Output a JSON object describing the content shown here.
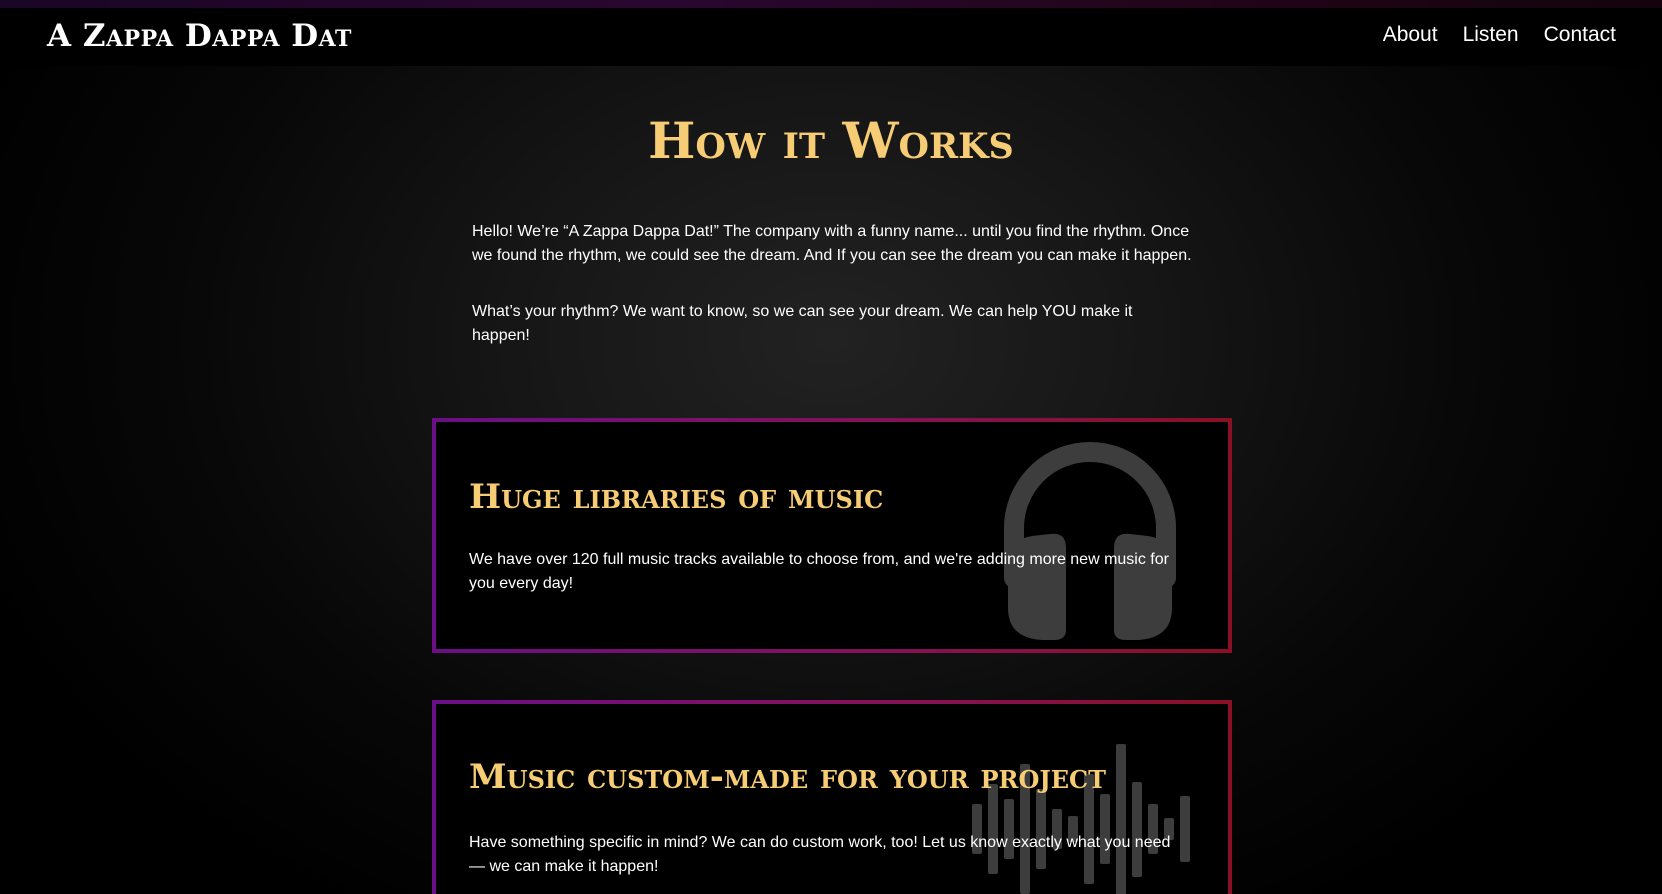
{
  "colors": {
    "accent": "#f6cc74",
    "background": "#000000",
    "card_border_start": "#6a0f86",
    "card_border_end": "#8a1026",
    "icon_gray": "#3d3d3d"
  },
  "header": {
    "brand": "A Zappa Dappa Dat",
    "nav": [
      {
        "label": "About"
      },
      {
        "label": "Listen"
      },
      {
        "label": "Contact"
      }
    ]
  },
  "main": {
    "title": "How it Works",
    "intro": [
      "Hello! We’re “A Zappa Dappa Dat!” The company with a funny name... until you find the rhythm. Once we found the rhythm, we could see the dream. And If you can see the dream you can make it happen.",
      "What’s your rhythm? We want to know, so we can see your dream. We can help YOU make it happen!"
    ],
    "cards": [
      {
        "heading": "Huge libraries of music",
        "text": "We have over 120 full music tracks available to choose from, and we're adding more new music for you every day!",
        "icon": "headphones-icon"
      },
      {
        "heading": "Music custom-made for your project",
        "text": "Have something specific in mind? We can do custom work, too! Let us know exactly what you need — we can make it happen!",
        "icon": "waveform-icon"
      }
    ]
  }
}
